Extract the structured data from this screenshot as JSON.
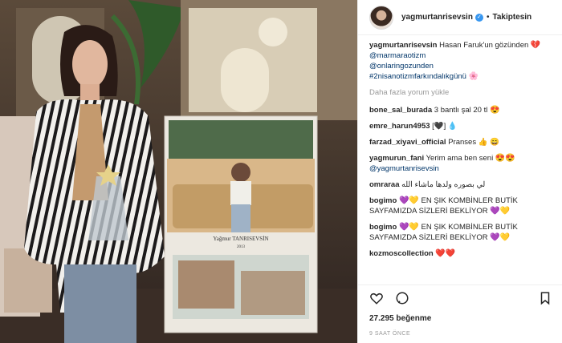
{
  "post": {
    "username": "yagmurtanrisevsin",
    "follow_label": "Takiptesin",
    "caption_user": "yagmurtanrisevsin",
    "caption_text": "Hasan Faruk'un gözünden",
    "caption_tags": [
      "@marmaraotizm",
      "@onlaringozunden",
      "#2nisanotizmfarkındalıkgünü"
    ],
    "load_more": "Daha fazla yorum yükle",
    "comments": [
      {
        "user": "bone_sal_burada",
        "text": "3 bantlı şal 20 tl"
      },
      {
        "user": "emre_harun4953",
        "text": "[🖤] 💧"
      },
      {
        "user": "farzad_xiyavi_official",
        "text": "Pranses 👍 😄"
      },
      {
        "user": "yagmurun_fani",
        "text": "Yerim ama ben seni",
        "tag": "@yagmurtanrisevsin"
      },
      {
        "user": "omraraa",
        "text": "لي بصوره ولدها ماشاء الله"
      },
      {
        "user": "bogimo",
        "text": "EN ŞIK KOMBİNLER BUTİK SAYFAMIZDA SİZLERİ BEKLİYOR"
      },
      {
        "user": "bogimo",
        "text": "EN ŞIK KOMBİNLER BUTİK SAYFAMIZDA SİZLERİ BEKLİYOR"
      },
      {
        "user": "kozmoscollection",
        "text": ""
      }
    ],
    "likes": "27.295 beğenme",
    "time": "9 SAAT ÖNCE"
  },
  "photo": {
    "poster_name": "Yağmur TANRISEVSİN",
    "poster_year": "2013"
  },
  "icons": [
    "heart-icon",
    "comment-icon",
    "bookmark-icon",
    "verified-badge-icon"
  ]
}
